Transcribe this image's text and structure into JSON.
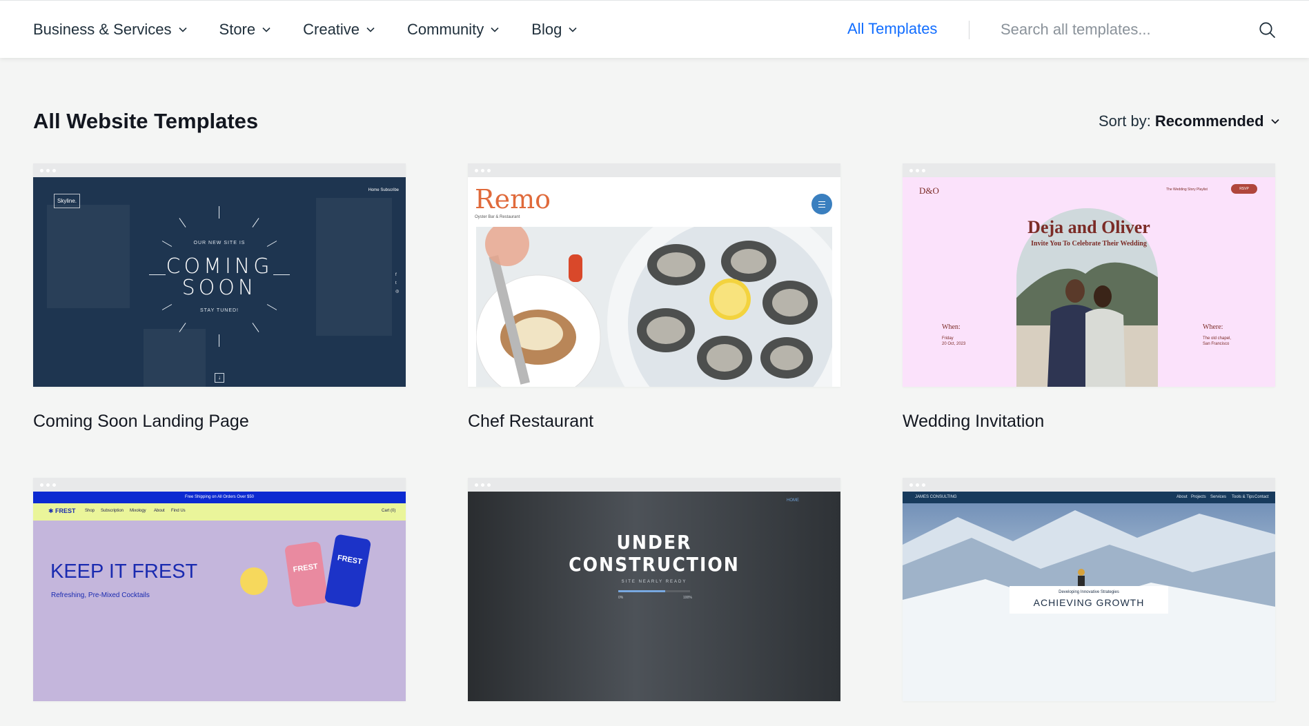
{
  "nav": {
    "items": [
      {
        "label": "Business & Services"
      },
      {
        "label": "Store"
      },
      {
        "label": "Creative"
      },
      {
        "label": "Community"
      },
      {
        "label": "Blog"
      }
    ],
    "all_templates": "All Templates",
    "search_placeholder": "Search all templates...",
    "accent_color": "#116dff"
  },
  "header": {
    "title": "All Website Templates",
    "sort_label": "Sort by:",
    "sort_value": "Recommended"
  },
  "templates": [
    {
      "name": "Coming Soon Landing Page",
      "preview": {
        "logo": "Skyline.",
        "menu": "Home     Subscribe",
        "kicker": "OUR NEW SITE IS",
        "line1": "COMING",
        "line2": "SOON",
        "footer": "STAY TUNED!",
        "social": [
          "f",
          "t",
          "◎"
        ]
      }
    },
    {
      "name": "Chef Restaurant",
      "preview": {
        "brand": "Remo",
        "subtitle": "Oyster Bar & Restaurant"
      }
    },
    {
      "name": "Wedding Invitation",
      "preview": {
        "logo": "D&O",
        "menu": "The Wedding     Story     Playlist",
        "button": "RSVP",
        "names": "Deja and Oliver",
        "invite": "Invite You To Celebrate Their Wedding",
        "when_label": "When:",
        "when_detail": [
          "Friday",
          "20 Oct, 2023"
        ],
        "where_label": "Where:",
        "where_detail": [
          "The old chapel,",
          "San Francisco"
        ]
      }
    },
    {
      "name": "",
      "preview": {
        "banner": "Free Shipping on All Orders Over $50",
        "logo": "✱ FREST",
        "menu": [
          "Shop",
          "Subscription",
          "Mixology",
          "About",
          "Find Us"
        ],
        "cart": "Cart (0)",
        "hero": "KEEP IT FREST",
        "tagline": "Refreshing, Pre-Mixed Cocktails",
        "can1": "FREST",
        "can2": "FREST"
      }
    },
    {
      "name": "",
      "preview": {
        "home": "HOME",
        "line1": "UNDER",
        "line2": "CONSTRUCTION",
        "sub": "SITE NEARLY READY",
        "progress": 0.65,
        "start_label": "0%",
        "end_label": "100%"
      }
    },
    {
      "name": "",
      "preview": {
        "logo": "JAMES CONSULTING",
        "menu": [
          "About",
          "Projects",
          "Services",
          "Tools & Tips",
          "Contact"
        ],
        "kicker": "Developing Innovative Strategies",
        "headline": "ACHIEVING GROWTH"
      }
    }
  ]
}
